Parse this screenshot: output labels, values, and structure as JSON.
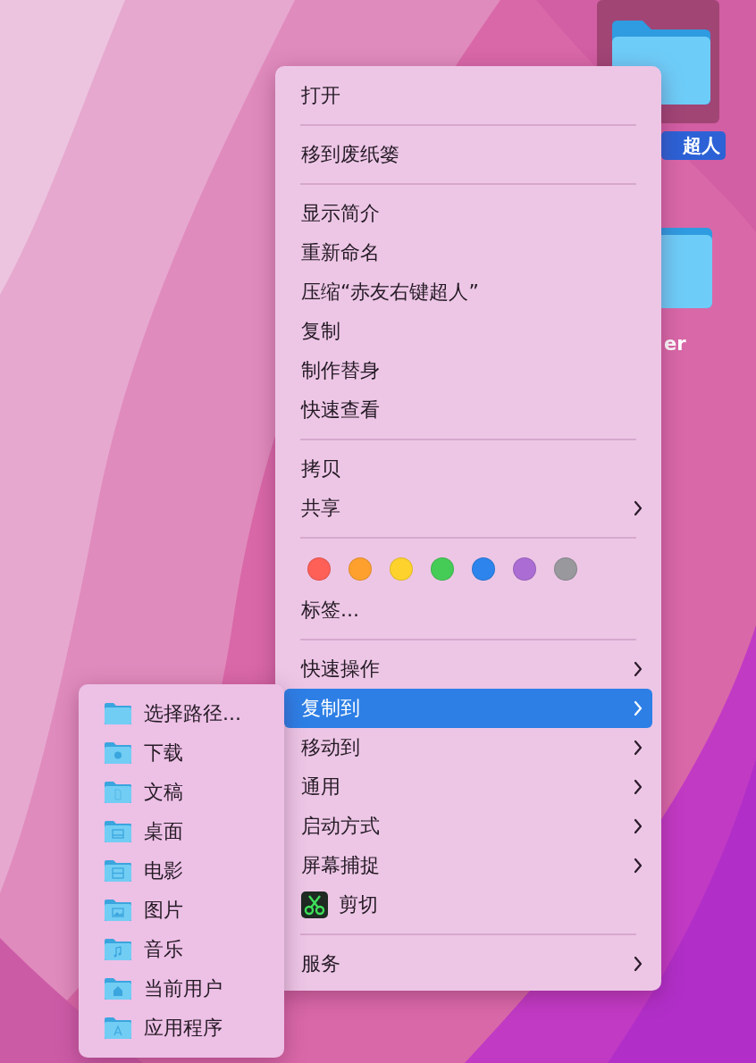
{
  "desktop": {
    "icons": [
      {
        "label": "超人",
        "selected": true
      },
      {
        "label": "er"
      }
    ]
  },
  "menu": {
    "items": [
      {
        "kind": "item",
        "label": "打开",
        "submenu": false,
        "selected": false
      },
      {
        "kind": "separator"
      },
      {
        "kind": "item",
        "label": "移到废纸篓",
        "submenu": false,
        "selected": false
      },
      {
        "kind": "separator"
      },
      {
        "kind": "item",
        "label": "显示简介",
        "submenu": false,
        "selected": false
      },
      {
        "kind": "item",
        "label": "重新命名",
        "submenu": false,
        "selected": false
      },
      {
        "kind": "item",
        "label": "压缩“赤友右键超人”",
        "submenu": false,
        "selected": false
      },
      {
        "kind": "item",
        "label": "复制",
        "submenu": false,
        "selected": false
      },
      {
        "kind": "item",
        "label": "制作替身",
        "submenu": false,
        "selected": false
      },
      {
        "kind": "item",
        "label": "快速查看",
        "submenu": false,
        "selected": false
      },
      {
        "kind": "separator"
      },
      {
        "kind": "item",
        "label": "拷贝",
        "submenu": false,
        "selected": false
      },
      {
        "kind": "item",
        "label": "共享",
        "submenu": true,
        "selected": false
      },
      {
        "kind": "separator"
      },
      {
        "kind": "tags",
        "dots": [
          {
            "color": "#fe5f57"
          },
          {
            "color": "#fea02e"
          },
          {
            "color": "#fdd22d"
          },
          {
            "color": "#45cc57"
          },
          {
            "color": "#2d84ec"
          },
          {
            "color": "#ab6dd4"
          },
          {
            "color": "#98989d"
          }
        ]
      },
      {
        "kind": "item",
        "label": "标签...",
        "submenu": false,
        "selected": false
      },
      {
        "kind": "separator"
      },
      {
        "kind": "item",
        "label": "快速操作",
        "submenu": true,
        "selected": false
      },
      {
        "kind": "item",
        "label": "复制到",
        "submenu": true,
        "selected": true
      },
      {
        "kind": "item",
        "label": "移动到",
        "submenu": true,
        "selected": false
      },
      {
        "kind": "item",
        "label": "通用",
        "submenu": true,
        "selected": false
      },
      {
        "kind": "item",
        "label": "启动方式",
        "submenu": true,
        "selected": false
      },
      {
        "kind": "item",
        "label": "屏幕捕捉",
        "submenu": true,
        "selected": false
      },
      {
        "kind": "app",
        "label": "剪切",
        "submenu": false,
        "selected": false
      },
      {
        "kind": "separator"
      },
      {
        "kind": "item",
        "label": "服务",
        "submenu": true,
        "selected": false
      }
    ]
  },
  "submenu": {
    "items": [
      {
        "kind": "plain",
        "label": "选择路径..."
      },
      {
        "kind": "downloads",
        "label": "下载"
      },
      {
        "kind": "documents",
        "label": "文稿"
      },
      {
        "kind": "desktop",
        "label": "桌面"
      },
      {
        "kind": "movies",
        "label": "电影"
      },
      {
        "kind": "pictures",
        "label": "图片"
      },
      {
        "kind": "music",
        "label": "音乐"
      },
      {
        "kind": "home",
        "label": "当前用户"
      },
      {
        "kind": "apps",
        "label": "应用程序"
      }
    ]
  }
}
